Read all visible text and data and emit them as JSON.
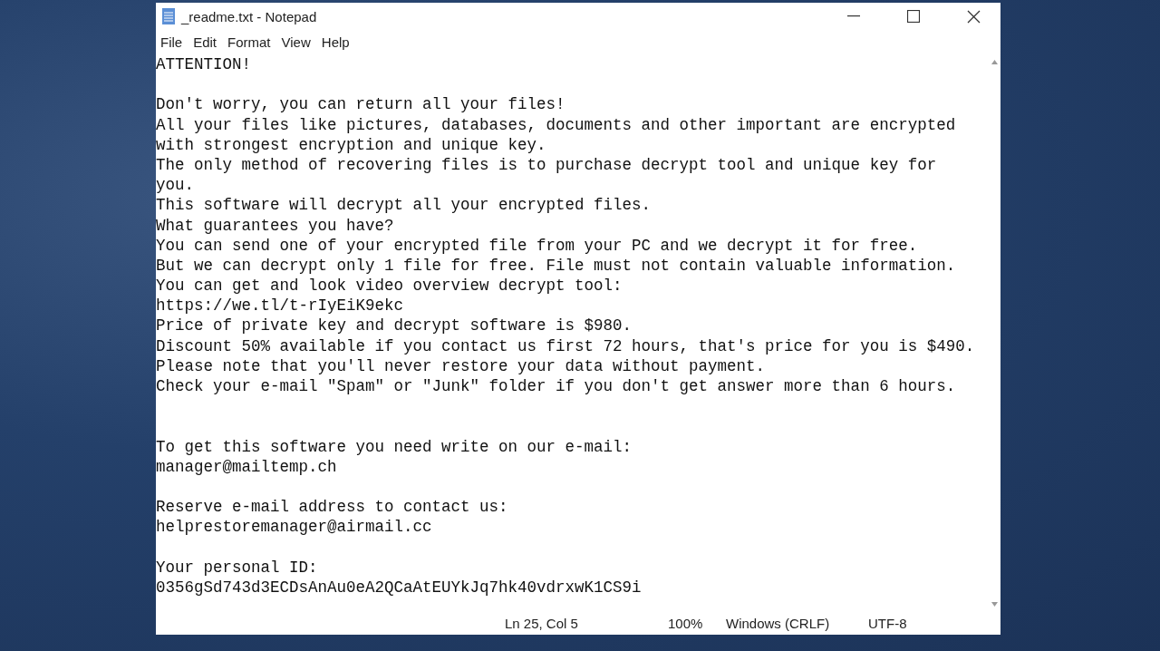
{
  "window": {
    "title": "_readme.txt - Notepad"
  },
  "menu": [
    "File",
    "Edit",
    "Format",
    "View",
    "Help"
  ],
  "document": {
    "lines": [
      {
        "kind": "text",
        "text": "ATTENTION!"
      },
      {
        "kind": "blank"
      },
      {
        "kind": "text",
        "text": "Don't worry, you can return all your files!"
      },
      {
        "kind": "text",
        "text": "All your files like pictures, databases, documents and other important are encrypted"
      },
      {
        "kind": "text",
        "text": "with strongest encryption and unique key."
      },
      {
        "kind": "text",
        "text": "The only method of recovering files is to purchase decrypt tool and unique key for"
      },
      {
        "kind": "text",
        "text": "you."
      },
      {
        "kind": "text",
        "text": "This software will decrypt all your encrypted files."
      },
      {
        "kind": "text",
        "text": "What guarantees you have?"
      },
      {
        "kind": "text",
        "text": "You can send one of your encrypted file from your PC and we decrypt it for free."
      },
      {
        "kind": "text",
        "text": "But we can decrypt only 1 file for free. File must not contain valuable information."
      },
      {
        "kind": "text",
        "text": "You can get and look video overview decrypt tool:"
      },
      {
        "kind": "text",
        "text": "https://we.tl/t-rIyEiK9ekc"
      },
      {
        "kind": "text",
        "text": "Price of private key and decrypt software is $980."
      },
      {
        "kind": "text",
        "text": "Discount 50% available if you contact us first 72 hours, that's price for you is $490."
      },
      {
        "kind": "text",
        "text": "Please note that you'll never restore your data without payment."
      },
      {
        "kind": "text",
        "text": "Check your e-mail \"Spam\" or \"Junk\" folder if you don't get answer more than 6 hours."
      },
      {
        "kind": "blank"
      },
      {
        "kind": "blank"
      },
      {
        "kind": "text",
        "text": "To get this software you need write on our e-mail:"
      },
      {
        "kind": "text",
        "text": "manager@mailtemp.ch"
      },
      {
        "kind": "blank"
      },
      {
        "kind": "text",
        "text": "Reserve e-mail address to contact us:"
      },
      {
        "kind": "text",
        "text": "helprestoremanager@airmail.cc"
      },
      {
        "kind": "blank"
      },
      {
        "kind": "text",
        "text": "Your personal ID:"
      },
      {
        "kind": "text",
        "text": "0356gSd743d3ECDsAnAu0eA2QCaAtEUYkJq7hk40vdrxwK1CS9i"
      }
    ]
  },
  "status_bar": [
    "Ln 25, Col 5",
    "100%",
    "Windows (CRLF)",
    "UTF-8"
  ]
}
